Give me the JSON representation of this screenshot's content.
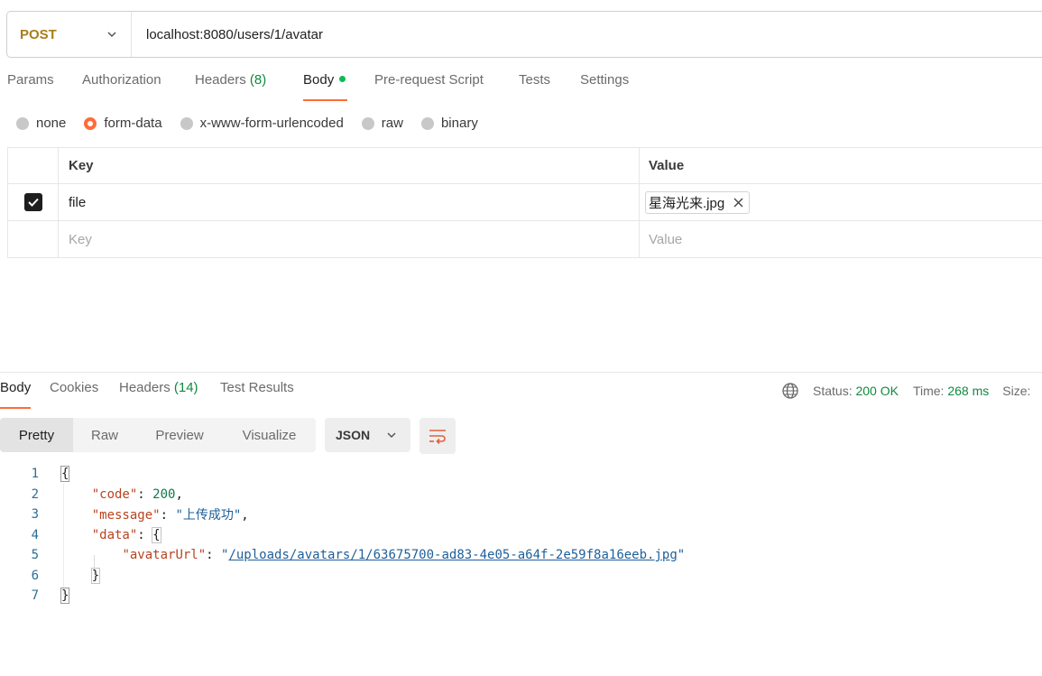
{
  "request": {
    "method": "POST",
    "url": "localhost:8080/users/1/avatar"
  },
  "request_tabs": [
    {
      "label": "Params",
      "count": ""
    },
    {
      "label": "Authorization",
      "count": ""
    },
    {
      "label": "Headers",
      "count": "(8)"
    },
    {
      "label": "Body",
      "count": ""
    },
    {
      "label": "Pre-request Script",
      "count": ""
    },
    {
      "label": "Tests",
      "count": ""
    },
    {
      "label": "Settings",
      "count": ""
    }
  ],
  "body_types": [
    "none",
    "form-data",
    "x-www-form-urlencoded",
    "raw",
    "binary"
  ],
  "body_type_selected": "form-data",
  "params_table": {
    "headers": {
      "key": "Key",
      "value": "Value"
    },
    "rows": [
      {
        "checked": true,
        "key": "file",
        "value_file": "星海光来.jpg"
      }
    ],
    "placeholder": {
      "key": "Key",
      "value": "Value"
    }
  },
  "response_tabs": [
    {
      "label": "Body",
      "count": ""
    },
    {
      "label": "Cookies",
      "count": ""
    },
    {
      "label": "Headers",
      "count": "(14)"
    },
    {
      "label": "Test Results",
      "count": ""
    }
  ],
  "response_meta": {
    "status_label": "Status:",
    "status_value": "200 OK",
    "time_label": "Time:",
    "time_value": "268 ms",
    "size_label": "Size:"
  },
  "view_modes": [
    "Pretty",
    "Raw",
    "Preview",
    "Visualize"
  ],
  "format": "JSON",
  "code_lines": [
    {
      "n": "1"
    },
    {
      "n": "2",
      "key": "\"code\"",
      "value": "200"
    },
    {
      "n": "3",
      "key": "\"message\"",
      "value": "\"上传成功\""
    },
    {
      "n": "4",
      "key": "\"data\""
    },
    {
      "n": "5",
      "key": "\"avatarUrl\"",
      "value": "/uploads/avatars/1/63675700-ad83-4e05-a64f-2e59f8a16eeb.jpg"
    },
    {
      "n": "6"
    },
    {
      "n": "7"
    }
  ],
  "colors": {
    "accent": "#ff6c37",
    "method": "#a87e1b",
    "success": "#0f8a3e"
  }
}
